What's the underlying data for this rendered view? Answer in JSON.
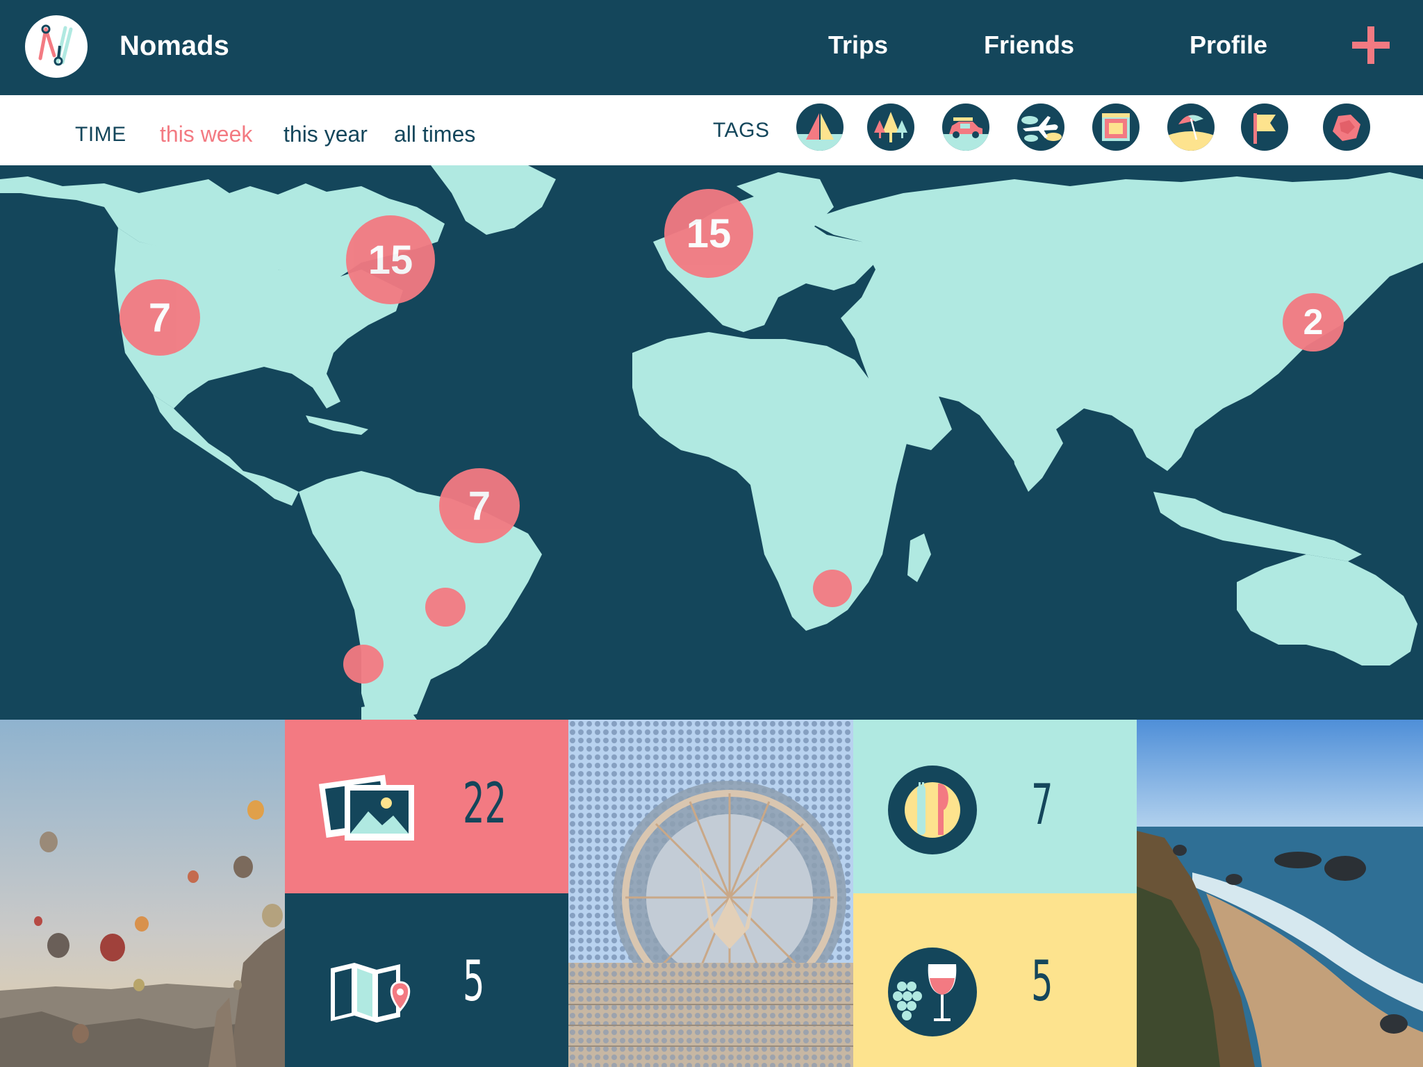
{
  "app": {
    "title": "Nomads"
  },
  "nav": {
    "items": [
      {
        "label": "Trips"
      },
      {
        "label": "Friends"
      },
      {
        "label": "Profile"
      }
    ],
    "add_icon": "plus-icon"
  },
  "filters": {
    "time_label": "TIME",
    "time_options": [
      "this week",
      "this year",
      "all times"
    ],
    "selected_time": "this week",
    "tags_label": "TAGS",
    "tags": [
      "camping",
      "forest",
      "road-trip",
      "flight",
      "city",
      "beach",
      "landmark",
      "food"
    ]
  },
  "map": {
    "clusters": [
      "7",
      "15",
      "15",
      "2",
      "7",
      "",
      "",
      ""
    ]
  },
  "stats": {
    "photos": {
      "icon": "photos-icon",
      "value": "22"
    },
    "maps": {
      "icon": "map-pin-icon",
      "value": "5"
    },
    "food": {
      "icon": "plate-cutlery-icon",
      "value": "7"
    },
    "wine": {
      "icon": "wine-grapes-icon",
      "value": "5"
    }
  },
  "colors": {
    "navy": "#14465b",
    "coral": "#f37a82",
    "mint": "#b0e9e1",
    "yellow": "#fde38e",
    "white": "#ffffff"
  }
}
